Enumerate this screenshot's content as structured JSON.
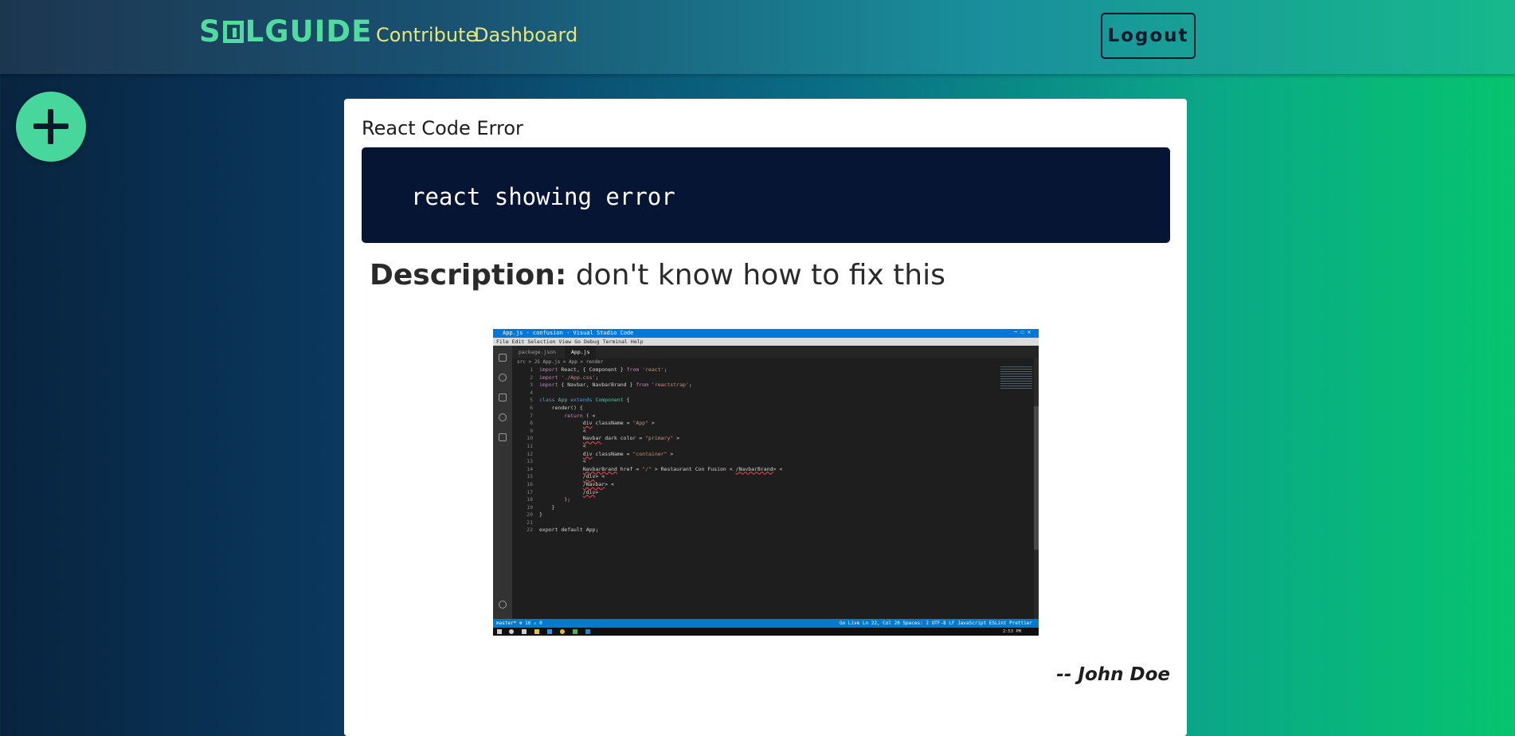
{
  "navbar": {
    "logo_left": "S",
    "logo_right": "LGUIDE",
    "links": [
      "Contribute",
      "Dashboard"
    ],
    "logout_label": "Logout",
    "accent": "#4fdc9e"
  },
  "fab": {
    "icon": "plus-icon"
  },
  "post": {
    "title": "React Code Error",
    "code": "react showing error",
    "description_label": "Description:",
    "description": " don't know how to fix this",
    "author": "-- John Doe"
  },
  "screenshot": {
    "window_title": "App.js - confusion - Visual Studio Code",
    "menu": [
      "File",
      "Edit",
      "Selection",
      "View",
      "Go",
      "Debug",
      "Terminal",
      "Help"
    ],
    "tabs": [
      "package.json",
      "App.js"
    ],
    "breadcrumb": "src > JS App.js > App > render",
    "status_left": "master* ⊗ 16 ⚠ 0",
    "status_right": "Go Live   Ln 22, Col 20   Spaces: 2   UTF-8   LF   JavaScript   ESLint   Prettier",
    "clock": "2:53 PM"
  }
}
